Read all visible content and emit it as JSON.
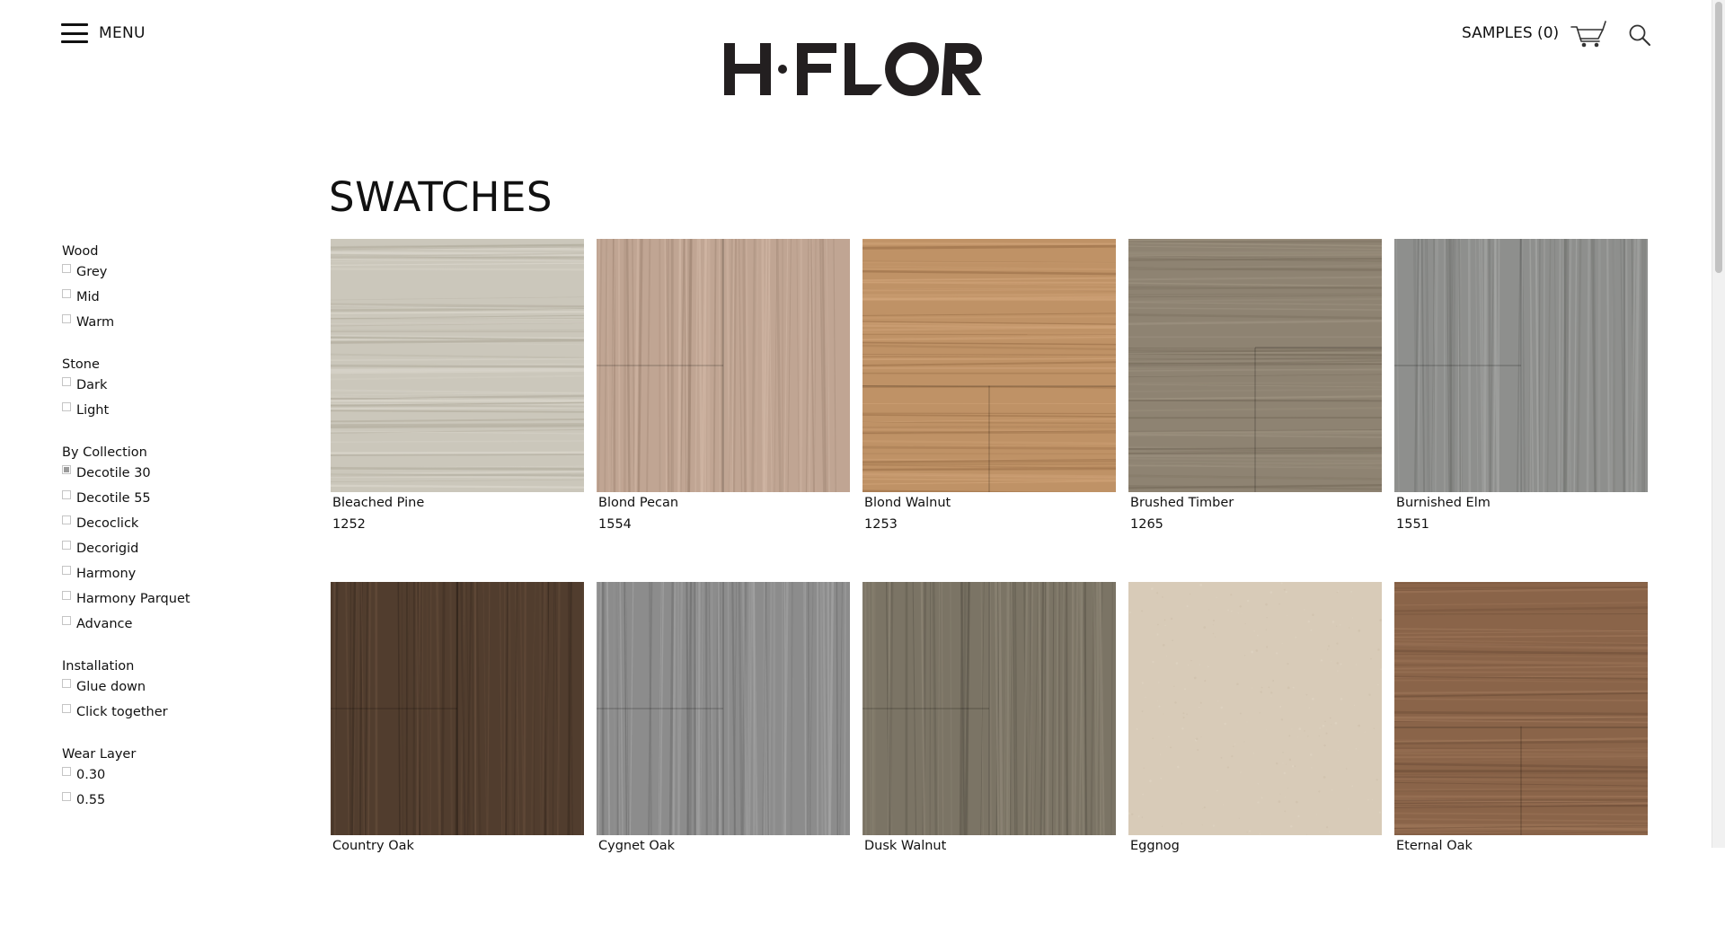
{
  "header": {
    "menu_label": "MENU",
    "brand": "H·FLOR",
    "samples_label": "SAMPLES (0)"
  },
  "icons": [
    "hamburger-icon",
    "cart-icon",
    "search-icon"
  ],
  "page_title": "SWATCHES",
  "filters": [
    {
      "title": "Wood",
      "options": [
        {
          "label": "Grey",
          "checked": false
        },
        {
          "label": "Mid",
          "checked": false
        },
        {
          "label": "Warm",
          "checked": false
        }
      ]
    },
    {
      "title": "Stone",
      "options": [
        {
          "label": "Dark",
          "checked": false
        },
        {
          "label": "Light",
          "checked": false
        }
      ]
    },
    {
      "title": "By Collection",
      "options": [
        {
          "label": "Decotile 30",
          "checked": true
        },
        {
          "label": "Decotile 55",
          "checked": false
        },
        {
          "label": "Decoclick",
          "checked": false
        },
        {
          "label": "Decorigid",
          "checked": false
        },
        {
          "label": "Harmony",
          "checked": false
        },
        {
          "label": "Harmony Parquet",
          "checked": false
        },
        {
          "label": "Advance",
          "checked": false
        }
      ]
    },
    {
      "title": "Installation",
      "options": [
        {
          "label": "Glue down",
          "checked": false
        },
        {
          "label": "Click together",
          "checked": false
        }
      ]
    },
    {
      "title": "Wear Layer",
      "options": [
        {
          "label": "0.30",
          "checked": false
        },
        {
          "label": "0.55",
          "checked": false
        }
      ]
    }
  ],
  "swatches": [
    {
      "name": "Bleached Pine",
      "code": "1252",
      "base": "#cbc7bb",
      "light": "#dcd8ce",
      "dark": "#b3ae9f"
    },
    {
      "name": "Blond Pecan",
      "code": "1554",
      "base": "#c0a593",
      "light": "#d2b8a6",
      "dark": "#a58b79"
    },
    {
      "name": "Blond Walnut",
      "code": "1253",
      "base": "#bf9266",
      "light": "#d2a57a",
      "dark": "#9f744c"
    },
    {
      "name": "Brushed Timber",
      "code": "1265",
      "base": "#8e8372",
      "light": "#9f9482",
      "dark": "#766b5b"
    },
    {
      "name": "Burnished Elm",
      "code": "1551",
      "base": "#8e8f8d",
      "light": "#a6a7a5",
      "dark": "#747572"
    },
    {
      "name": "Country Oak",
      "code": "",
      "base": "#513d2e",
      "light": "#654d3b",
      "dark": "#3b2c21"
    },
    {
      "name": "Cygnet Oak",
      "code": "",
      "base": "#8c8c8c",
      "light": "#a7a7a7",
      "dark": "#6c6c6c"
    },
    {
      "name": "Dusk Walnut",
      "code": "",
      "base": "#7b7465",
      "light": "#908878",
      "dark": "#5f594d"
    },
    {
      "name": "Eggnog",
      "code": "",
      "base": "#d8cbb8",
      "light": "#e2d7c6",
      "dark": "#cbbda8"
    },
    {
      "name": "Eternal Oak",
      "code": "",
      "base": "#8a6449",
      "light": "#9f775a",
      "dark": "#6e4e38"
    }
  ]
}
